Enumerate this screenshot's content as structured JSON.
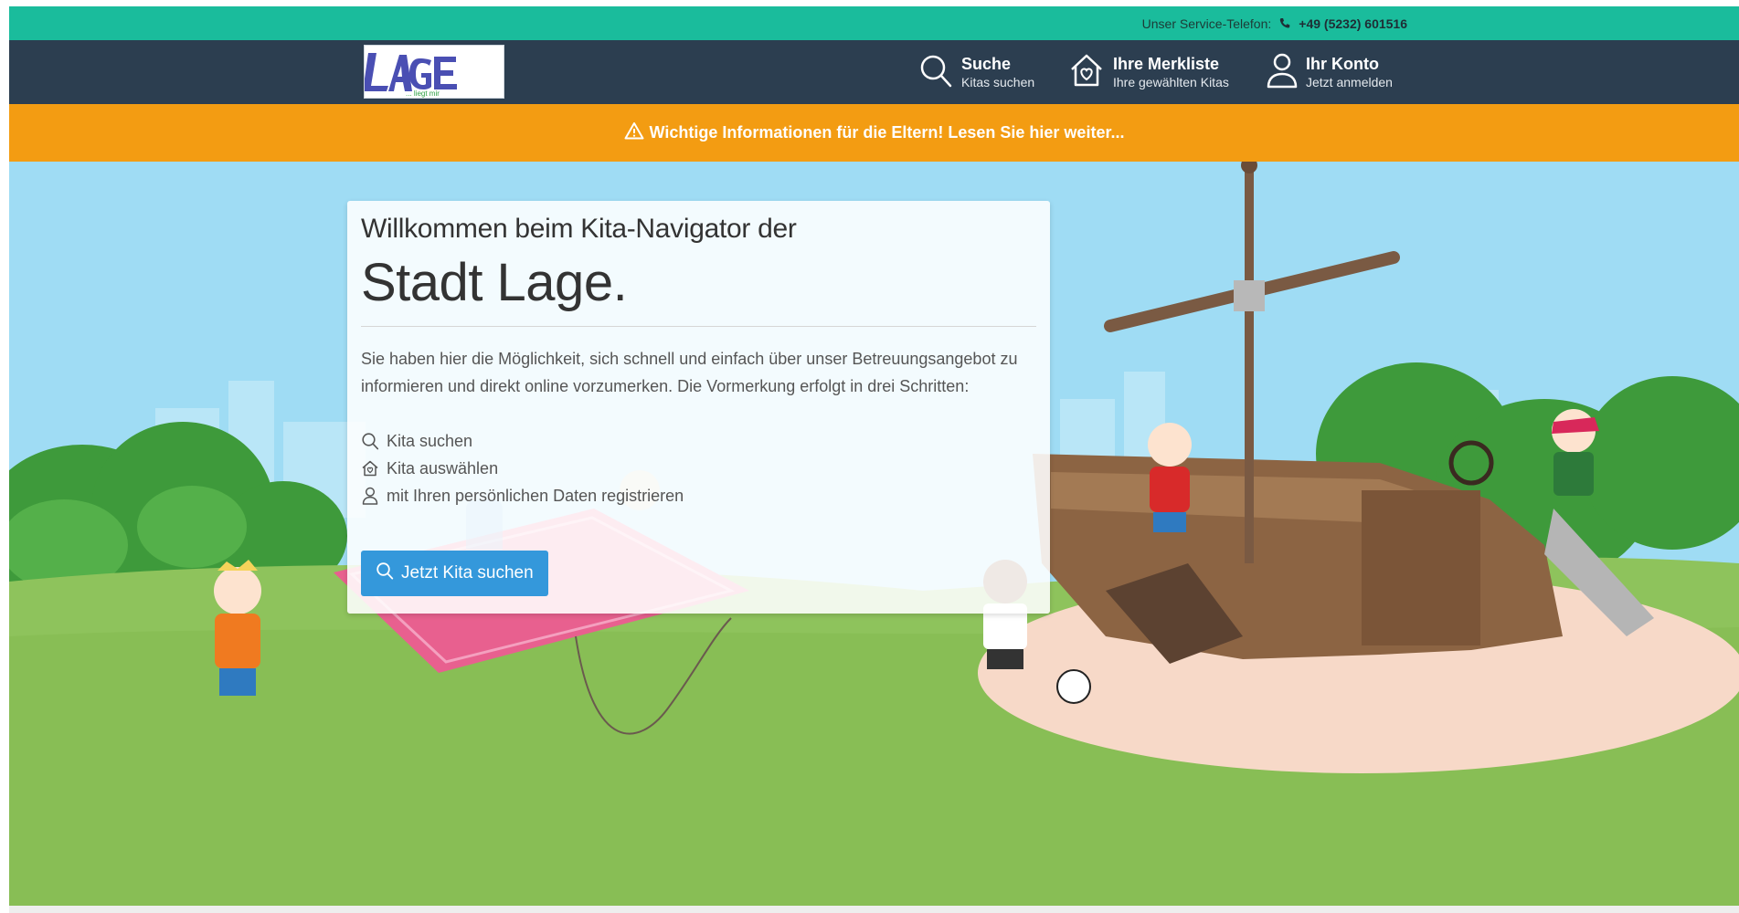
{
  "service_bar": {
    "label": "Unser Service-Telefon:",
    "phone": "+49 (5232) 601516"
  },
  "navbar": {
    "logo_text": "LAGE",
    "logo_tagline": "... liegt mir",
    "search": {
      "title": "Suche",
      "subtitle": "Kitas suchen",
      "icon": "search-icon"
    },
    "merkliste": {
      "title": "Ihre Merkliste",
      "subtitle": "Ihre gewählten Kitas",
      "icon": "house-heart-icon"
    },
    "konto": {
      "title": "Ihr Konto",
      "subtitle": "Jetzt anmelden",
      "icon": "user-icon"
    }
  },
  "notice": {
    "text": "Wichtige Informationen für die Eltern! Lesen Sie hier weiter...",
    "icon": "warning-icon"
  },
  "welcome": {
    "line1": "Willkommen beim Kita-Navigator der",
    "city": "Stadt Lage.",
    "intro": "Sie haben hier die Möglichkeit, sich schnell und einfach über unser Betreuungsangebot zu informieren und direkt online vorzumerken. Die Vormerkung erfolgt in drei Schritten:",
    "steps": [
      {
        "icon": "search-icon",
        "label": "Kita suchen"
      },
      {
        "icon": "house-heart-icon",
        "label": "Kita auswählen"
      },
      {
        "icon": "user-icon",
        "label": "mit Ihren persönlichen Daten registrieren"
      }
    ],
    "cta_label": "Jetzt Kita suchen"
  },
  "colors": {
    "service_bar": "#1abc9c",
    "navbar": "#2c3e50",
    "notice_bar": "#f39c12",
    "cta": "#3498db"
  }
}
